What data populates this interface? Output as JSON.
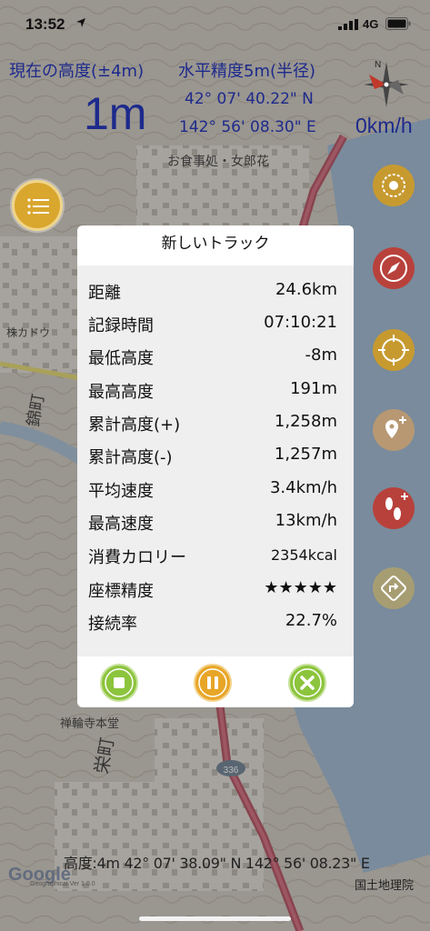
{
  "status_bar": {
    "time": "13:52",
    "network": "4G",
    "icons": [
      "location-arrow-icon",
      "signal-bars-icon",
      "battery-icon"
    ]
  },
  "header": {
    "altitude_label": "現在の高度(±4m)",
    "accuracy_label": "水平精度5m(半径)",
    "altitude_value": "1m",
    "latitude": "42° 07' 40.22\" N",
    "longitude": "142° 56' 08.30\" E",
    "speed": "0km/h",
    "compass_letter": "N"
  },
  "map": {
    "labels": {
      "restaurant": "お食事処・女郎花",
      "street_a": "錦町",
      "street_b": "栄町",
      "temple": "禅輪寺本堂",
      "route": "336",
      "hotel": "株カドウ"
    }
  },
  "dialog": {
    "title": "新しいトラック",
    "rows": [
      {
        "key": "距離",
        "value": "24.6km"
      },
      {
        "key": "記録時間",
        "value": "07:10:21"
      },
      {
        "key": "最低高度",
        "value": "-8m"
      },
      {
        "key": "最高高度",
        "value": "191m"
      },
      {
        "key": "累計高度(+)",
        "value": "1,258m"
      },
      {
        "key": "累計高度(-)",
        "value": "1,257m"
      },
      {
        "key": "平均速度",
        "value": "3.4km/h"
      },
      {
        "key": "最高速度",
        "value": "13km/h"
      },
      {
        "key": "消費カロリー",
        "value": "2354kcal"
      },
      {
        "key": "座標精度",
        "value": "★★★★★"
      },
      {
        "key": "接続率",
        "value": "22.7%"
      }
    ],
    "actions": [
      {
        "name": "stop-button",
        "icon": "stop-icon",
        "color": "#8cc43d"
      },
      {
        "name": "pause-button",
        "icon": "pause-icon",
        "color": "#e8a628"
      },
      {
        "name": "close-button",
        "icon": "close-icon",
        "color": "#8cc43d"
      }
    ]
  },
  "tools": [
    {
      "name": "sunflower-tool-button",
      "icon": "flower-icon",
      "color": "#d8a62e"
    },
    {
      "name": "compass-tool-button",
      "icon": "compass-icon",
      "color": "#c8473f"
    },
    {
      "name": "recenter-tool-button",
      "icon": "target-icon",
      "color": "#d8a62e"
    },
    {
      "name": "add-waypoint-button",
      "icon": "add-pin-icon",
      "color": "#c8a77a"
    },
    {
      "name": "footprints-button",
      "icon": "footprints-icon",
      "color": "#c8473f"
    },
    {
      "name": "route-tool-button",
      "icon": "route-sign-icon",
      "color": "#b5a97a"
    }
  ],
  "bottom": {
    "coordinates": "高度:4m  42° 07' 38.09\" N 142° 56' 08.23\" E",
    "google": "Google",
    "google_sub": "Geographical Ver 1.0.0",
    "gsi": "国土地理院"
  },
  "colors": {
    "header_text": "#1d2a8c",
    "accent_yellow": "#d9a62e",
    "accent_red": "#c8473f",
    "accent_green": "#8cc43d"
  }
}
